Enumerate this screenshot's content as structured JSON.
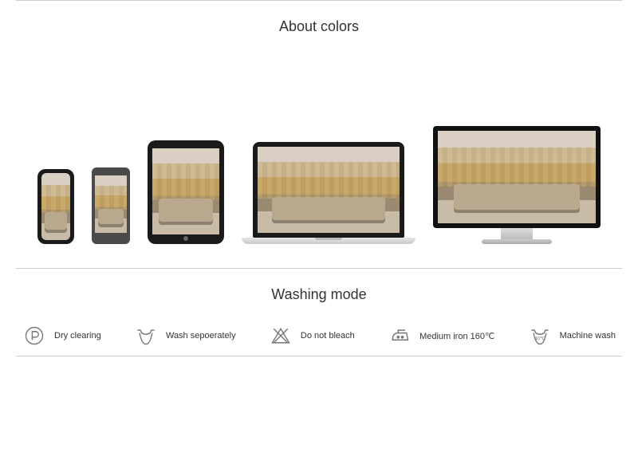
{
  "section_colors_title": "About colors",
  "section_washing_title": "Washing mode",
  "devices": [
    {
      "name": "phone-notch"
    },
    {
      "name": "phone-android"
    },
    {
      "name": "tablet"
    },
    {
      "name": "laptop"
    },
    {
      "name": "monitor"
    }
  ],
  "washing": {
    "items": [
      {
        "icon": "dry-clean-p-icon",
        "label": "Dry clearing"
      },
      {
        "icon": "wash-separately-icon",
        "label": "Wash sepoerately"
      },
      {
        "icon": "do-not-bleach-icon",
        "label": "Do not bleach"
      },
      {
        "icon": "iron-medium-icon",
        "label": "Medium iron 160℃"
      },
      {
        "icon": "machine-wash-40-icon",
        "label": "Machine wash"
      }
    ]
  }
}
